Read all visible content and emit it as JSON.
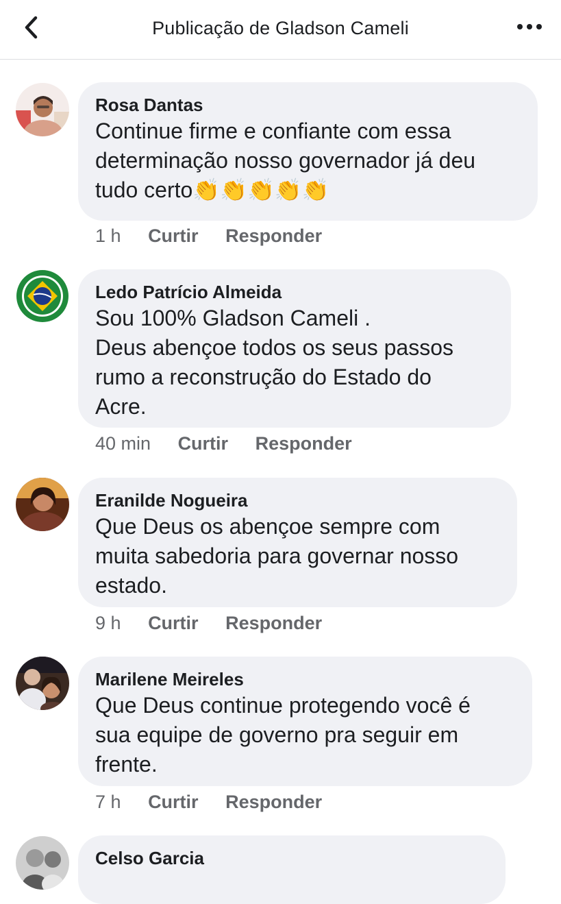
{
  "header": {
    "title": "Publicação de Gladson Cameli",
    "back_icon": "chevron-left-icon",
    "more_icon": "more-dots-icon"
  },
  "actions": {
    "like": "Curtir",
    "reply": "Responder"
  },
  "comments": [
    {
      "author": "Rosa Dantas",
      "text": "Continue firme e confiante com essa\ndeterminação nosso governador já deu\ntudo certo👏👏👏👏👏",
      "time": "1 h"
    },
    {
      "author": "Ledo Patrício Almeida",
      "text": "Sou 100% Gladson Cameli .\nDeus abençoe todos os seus passos\nrumo a reconstrução do Estado do\nAcre.",
      "time": "40 min"
    },
    {
      "author": "Eranilde Nogueira",
      "text": "Que Deus os abençoe sempre com\nmuita sabedoria para governar nosso\nestado.",
      "time": "9 h"
    },
    {
      "author": "Marilene Meireles",
      "text": "Que Deus continue protegendo você é\nsua equipe de governo pra seguir em\nfrente.",
      "time": "7 h"
    },
    {
      "author": "Celso Garcia",
      "text": "",
      "time": ""
    }
  ],
  "colors": {
    "bubble": "#f0f1f5",
    "meta_text": "#65676b",
    "primary_text": "#1c1e21",
    "divider": "#dcdde1"
  }
}
